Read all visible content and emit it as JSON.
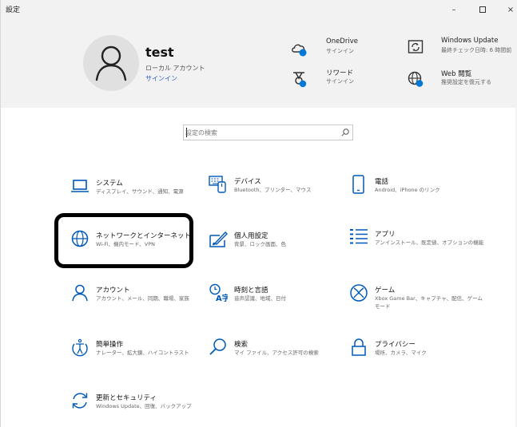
{
  "window": {
    "title": "設定",
    "minimize_glyph": "–",
    "close_glyph": "×"
  },
  "account": {
    "name": "test",
    "type": "ローカル アカウント",
    "signin": "サインイン"
  },
  "header_items": [
    {
      "title": "OneDrive",
      "subtitle": "サインイン",
      "icon": "onedrive-cloud-icon"
    },
    {
      "title": "リワード",
      "subtitle": "サインイン",
      "icon": "rewards-medal-icon"
    },
    {
      "title": "Windows Update",
      "subtitle": "最終チェック日時: 6 時間前",
      "icon": "windows-update-icon"
    },
    {
      "title": "Web 閲覧",
      "subtitle": "推奨設定を復元する",
      "icon": "web-browsing-globe-icon"
    }
  ],
  "search": {
    "placeholder": "設定の検索",
    "icon": "search-icon"
  },
  "categories": [
    {
      "title": "システム",
      "desc": "ディスプレイ、サウンド、通知、電源",
      "icon": "system-laptop-icon"
    },
    {
      "title": "デバイス",
      "desc": "Bluetooth、プリンター、マウス",
      "icon": "devices-keyboard-icon"
    },
    {
      "title": "電話",
      "desc": "Android、iPhone のリンク",
      "icon": "phone-icon"
    },
    {
      "title": "ネットワークとインターネット",
      "desc": "Wi-Fi、機内モード、VPN",
      "icon": "network-globe-icon"
    },
    {
      "title": "個人用設定",
      "desc": "背景、ロック画面、色",
      "icon": "personalization-brush-icon"
    },
    {
      "title": "アプリ",
      "desc": "アンインストール、既定値、オプションの機能",
      "icon": "apps-list-icon"
    },
    {
      "title": "アカウント",
      "desc": "アカウント、メール、同期、職場、家族",
      "icon": "accounts-person-icon"
    },
    {
      "title": "時刻と言語",
      "desc": "音声認識、地域、日付",
      "icon": "time-language-icon"
    },
    {
      "title": "ゲーム",
      "desc": "Xbox Game Bar、キャプチャ、配信、ゲーム モード",
      "icon": "gaming-xbox-icon"
    },
    {
      "title": "簡単操作",
      "desc": "ナレーター、拡大鏡、ハイコントラスト",
      "icon": "ease-of-access-icon"
    },
    {
      "title": "検索",
      "desc": "マイ ファイル、アクセス許可の検索",
      "icon": "search-magnifier-icon"
    },
    {
      "title": "プライバシー",
      "desc": "場所、カメラ、マイク",
      "icon": "privacy-lock-icon"
    },
    {
      "title": "更新とセキュリティ",
      "desc": "Windows Update、回復、バックアップ",
      "icon": "update-security-icon"
    }
  ],
  "colors": {
    "accent": "#0078d7",
    "header_bg": "#f2f2f2",
    "link": "#2e60c4",
    "highlight": "#000000"
  }
}
